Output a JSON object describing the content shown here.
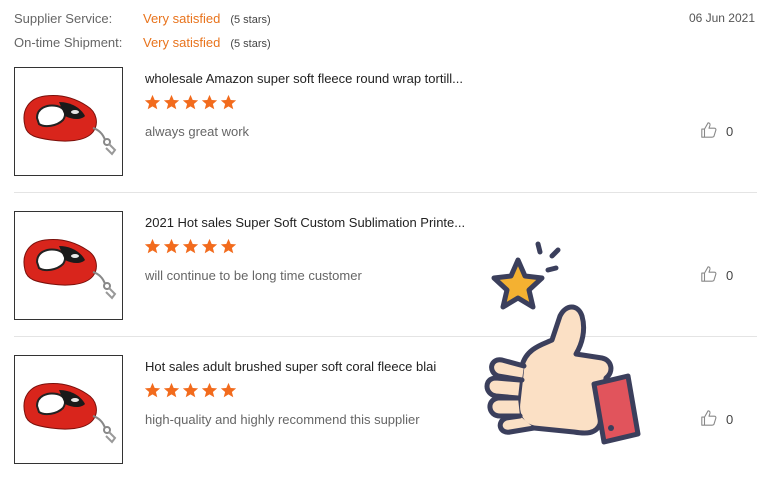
{
  "ratings": [
    {
      "label": "Supplier Service:",
      "value": "Very satisfied",
      "stars": "(5 stars)"
    },
    {
      "label": "On-time Shipment:",
      "value": "Very satisfied",
      "stars": "(5 stars)"
    }
  ],
  "date": "06 Jun 2021",
  "reviews": [
    {
      "title": "wholesale Amazon super soft fleece round wrap tortill...",
      "rating": 5,
      "comment": "always great work",
      "likes": "0"
    },
    {
      "title": "2021 Hot sales Super Soft Custom Sublimation Printe...",
      "rating": 5,
      "comment": "will continue to be long time customer",
      "likes": "0"
    },
    {
      "title": "Hot sales adult brushed super soft coral fleece blai",
      "rating": 5,
      "comment": "high-quality and highly recommend this supplier",
      "likes": "0"
    }
  ],
  "colors": {
    "accent": "#e8731c",
    "star": "#f26b1d",
    "leash": "#d9251c"
  },
  "icons": {
    "thumbs_up": "thumbs-up-icon",
    "star": "star-icon"
  }
}
